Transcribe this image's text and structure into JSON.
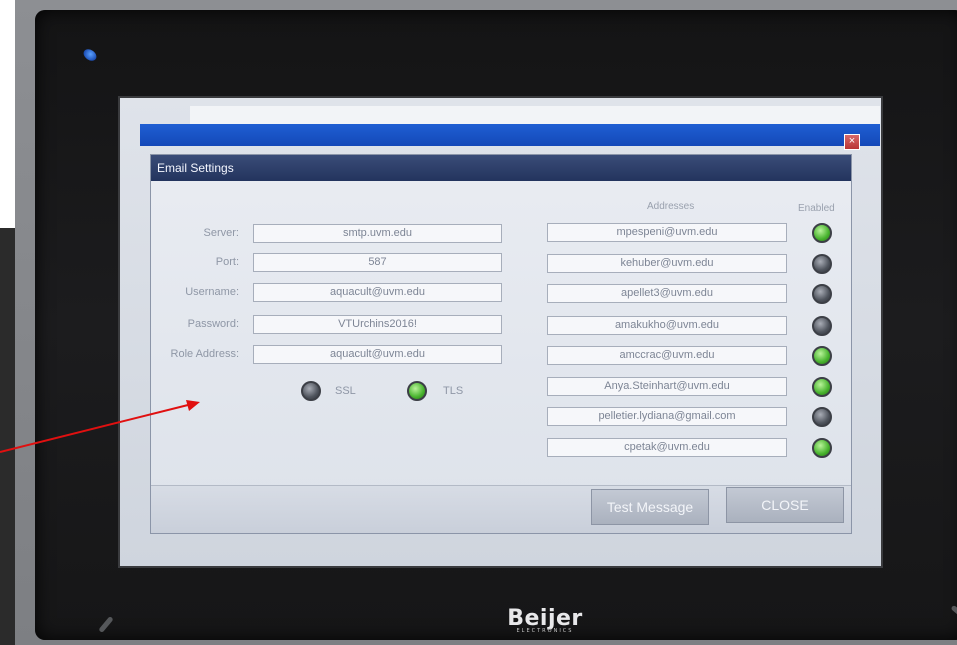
{
  "dialog": {
    "title": "Email Settings",
    "close_glyph": "×"
  },
  "server": {
    "fields": [
      {
        "label": "Server:",
        "value": "smtp.uvm.edu"
      },
      {
        "label": "Port:",
        "value": "587"
      },
      {
        "label": "Username:",
        "value": "aquacult@uvm.edu"
      },
      {
        "label": "Password:",
        "value": "VTUrchins2016!"
      },
      {
        "label": "Role Address:",
        "value": "aquacult@uvm.edu"
      }
    ],
    "security": [
      {
        "label": "SSL",
        "enabled": false
      },
      {
        "label": "TLS",
        "enabled": true
      }
    ]
  },
  "addresses": {
    "header": "Addresses",
    "enabled_header": "Enabled",
    "items": [
      {
        "email": "mpespeni@uvm.edu",
        "enabled": true
      },
      {
        "email": "kehuber@uvm.edu",
        "enabled": false
      },
      {
        "email": "apellet3@uvm.edu",
        "enabled": false
      },
      {
        "email": "amakukho@uvm.edu",
        "enabled": false
      },
      {
        "email": "amccrac@uvm.edu",
        "enabled": true
      },
      {
        "email": "Anya.Steinhart@uvm.edu",
        "enabled": true
      },
      {
        "email": "pelletier.lydiana@gmail.com",
        "enabled": false
      },
      {
        "email": "cpetak@uvm.edu",
        "enabled": true
      }
    ]
  },
  "buttons": {
    "test": "Test Message",
    "close": "CLOSE"
  },
  "device": {
    "brand": "Beijer",
    "brand_sub": "ELECTRONICS"
  },
  "colors": {
    "title_bar": "#1448b8",
    "indicator_on": "#46b22c",
    "indicator_off": "#4f545d",
    "annotation_arrow": "#e01010"
  }
}
